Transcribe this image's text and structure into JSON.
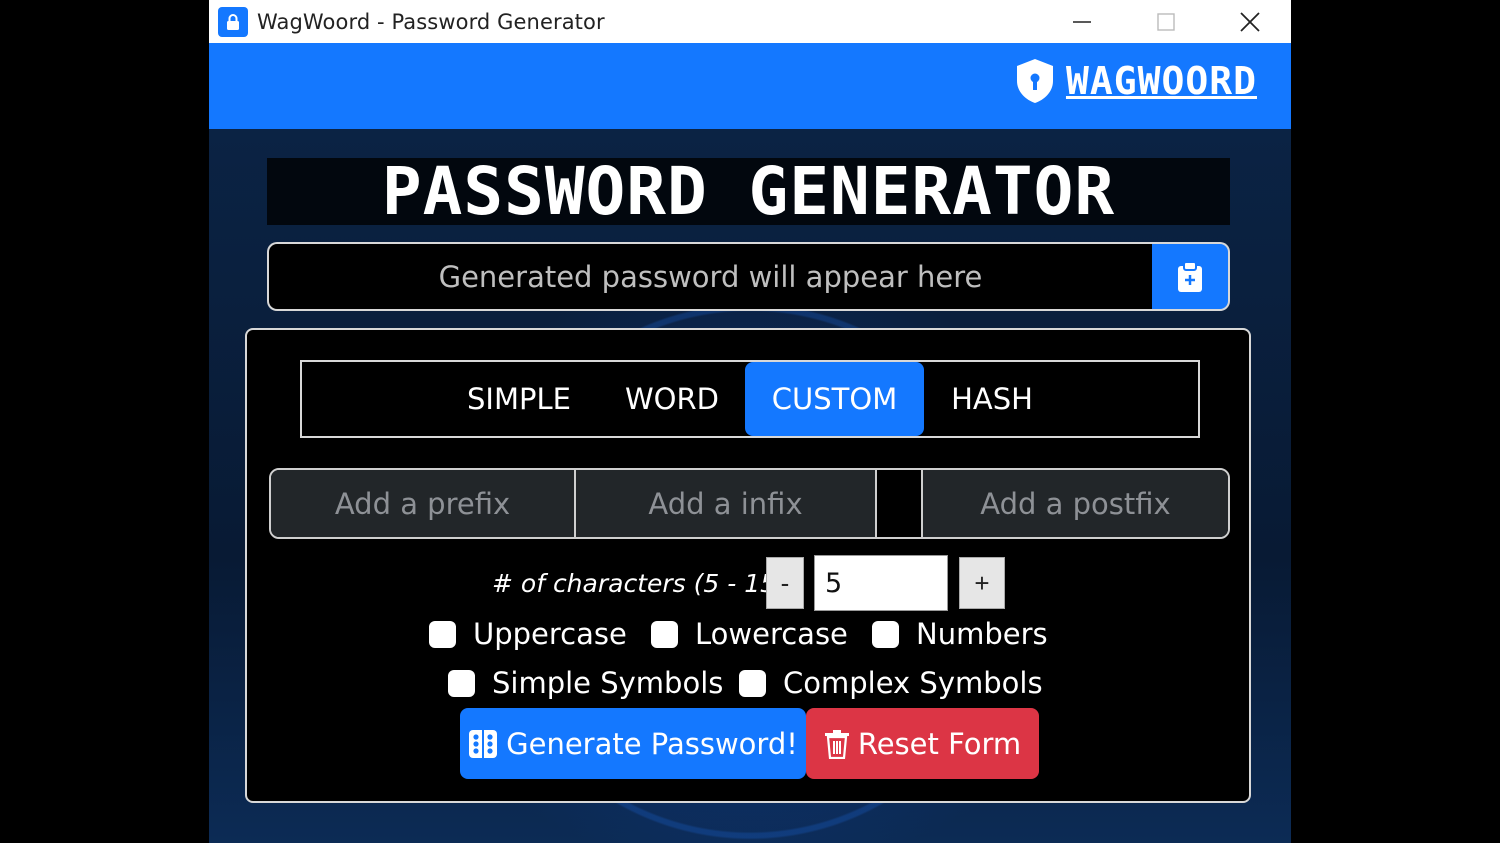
{
  "window": {
    "title": "WagWoord - Password Generator"
  },
  "header": {
    "brand": "WAGWOORD"
  },
  "main": {
    "title": "PASSWORD GENERATOR",
    "password_placeholder": "Generated password will appear here"
  },
  "tabs": [
    {
      "label": "SIMPLE",
      "active": false
    },
    {
      "label": "WORD",
      "active": false
    },
    {
      "label": "CUSTOM",
      "active": true
    },
    {
      "label": "HASH",
      "active": false
    }
  ],
  "affixes": {
    "prefix_placeholder": "Add a prefix",
    "infix_placeholder": "Add a infix",
    "postfix_placeholder": "Add a postfix"
  },
  "characters": {
    "label": "# of characters (5 - 15):",
    "minus": "-",
    "value": "5",
    "plus": "+"
  },
  "options": [
    {
      "label": "Uppercase",
      "checked": false
    },
    {
      "label": "Lowercase",
      "checked": false
    },
    {
      "label": "Numbers",
      "checked": false
    },
    {
      "label": "Simple Symbols",
      "checked": false
    },
    {
      "label": "Complex Symbols",
      "checked": false
    }
  ],
  "buttons": {
    "generate": "Generate Password!",
    "reset": "Reset Form"
  },
  "icons": {
    "app": "lock-icon",
    "copy": "clipboard-icon",
    "generate": "dice-icon",
    "reset": "trash-icon",
    "brand": "shield-keyhole-icon"
  },
  "colors": {
    "primary": "#1478ff",
    "danger": "#dc3545"
  }
}
